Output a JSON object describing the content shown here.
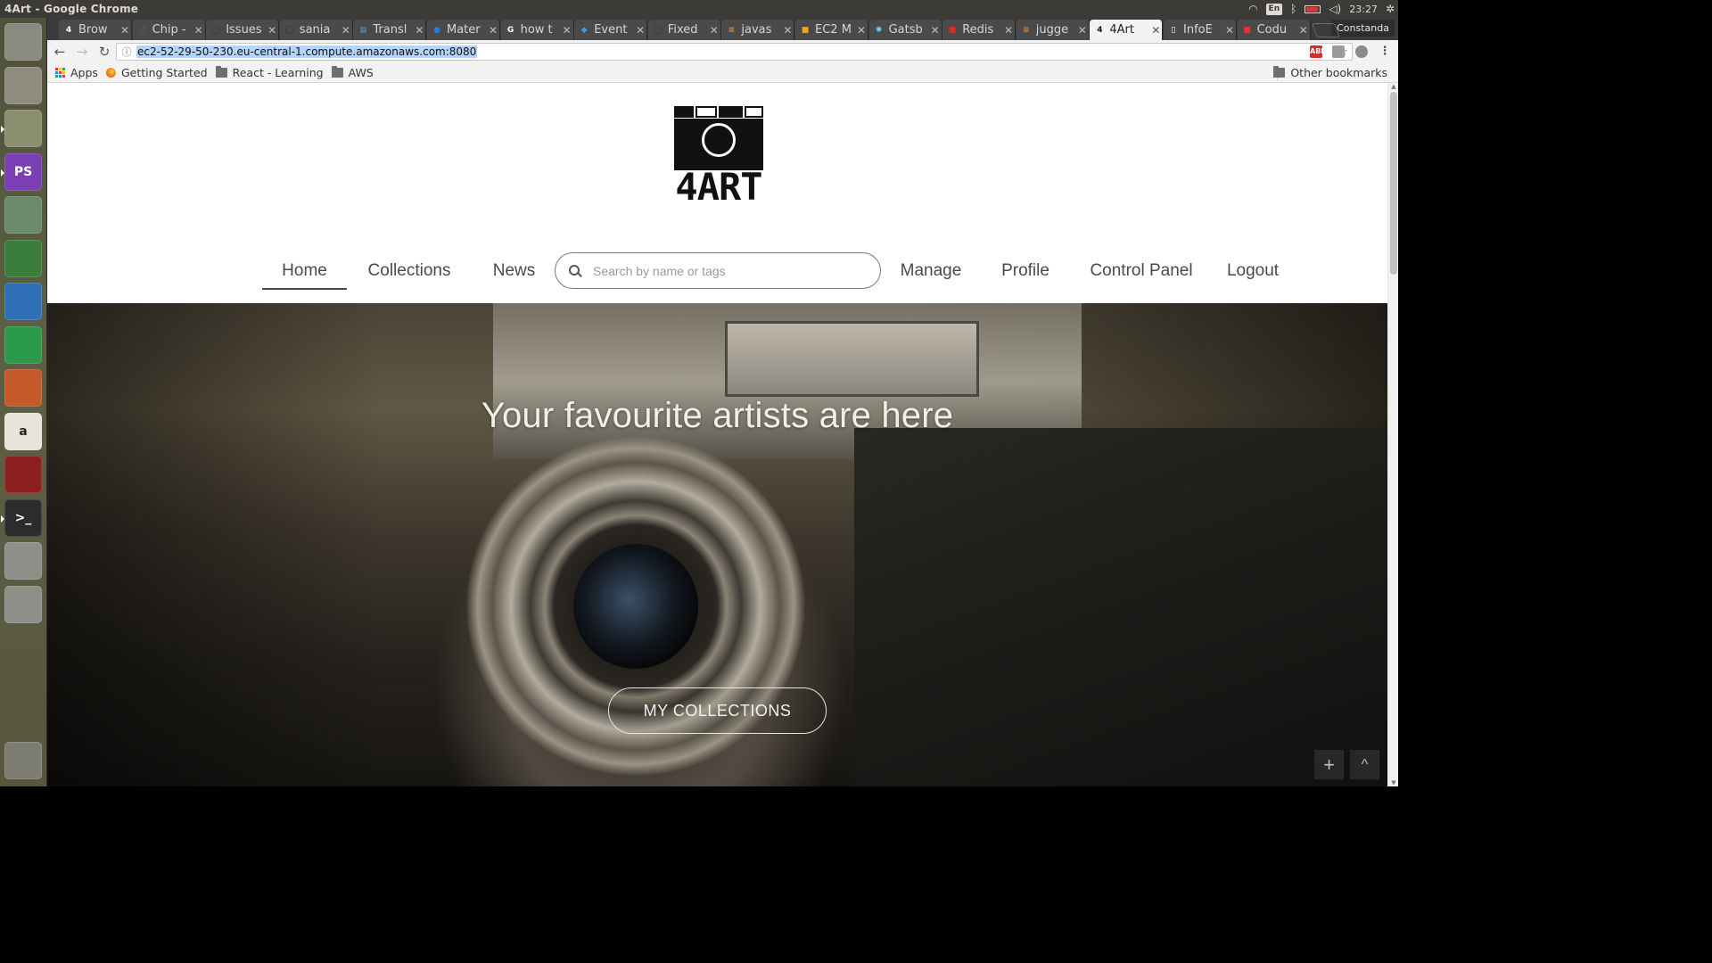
{
  "os": {
    "window_title": "4Art - Google Chrome",
    "clock": "23:27",
    "keyboard_layout": "En",
    "user": "Constanda"
  },
  "browser": {
    "tabs": [
      {
        "label": "Brow",
        "favicon": "4",
        "color": "#ffffff"
      },
      {
        "label": "Chip -",
        "favicon": "↺",
        "color": "#555555"
      },
      {
        "label": "Issues",
        "favicon": "◯",
        "color": "#333333"
      },
      {
        "label": "sania",
        "favicon": "◯",
        "color": "#333333"
      },
      {
        "label": "Transl",
        "favicon": "▦",
        "color": "#5b7fb5"
      },
      {
        "label": "Mater",
        "favicon": "●",
        "color": "#2a7bde"
      },
      {
        "label": "how t",
        "favicon": "G",
        "color": "#ffffff"
      },
      {
        "label": "Event",
        "favicon": "◆",
        "color": "#3aa0e8"
      },
      {
        "label": "Fixed",
        "favicon": "◯",
        "color": "#333333"
      },
      {
        "label": "javas",
        "favicon": "≡",
        "color": "#f48024"
      },
      {
        "label": "EC2 M",
        "favicon": "■",
        "color": "#f0a31e"
      },
      {
        "label": "Gatsb",
        "favicon": "✺",
        "color": "#61dafb"
      },
      {
        "label": "Redis",
        "favicon": "■",
        "color": "#d82c20"
      },
      {
        "label": "jugge",
        "favicon": "≡",
        "color": "#f48024"
      },
      {
        "label": "4Art",
        "favicon": "4",
        "color": "#111111",
        "active": true
      },
      {
        "label": "InfoE",
        "favicon": "▯",
        "color": "#ffffff"
      },
      {
        "label": "Codu",
        "favicon": "■",
        "color": "#e23636"
      }
    ],
    "url": "ec2-52-29-50-230.eu-central-1.compute.amazonaws.com:8080",
    "bookmarks": [
      {
        "label": "Apps",
        "icon": "apps-grid-icon"
      },
      {
        "label": "Getting Started",
        "icon": "firefox-icon"
      },
      {
        "label": "React - Learning",
        "icon": "folder-icon"
      },
      {
        "label": "AWS",
        "icon": "folder-icon"
      }
    ],
    "other_bookmarks": "Other bookmarks",
    "extensions": [
      "ABP"
    ]
  },
  "launcher": {
    "apps": [
      {
        "name": "ubuntu-dash-icon",
        "label": "",
        "color": "#8a8a80"
      },
      {
        "name": "files-icon",
        "label": "",
        "color": "#8f8b7e"
      },
      {
        "name": "chrome-icon",
        "label": "",
        "color": "#8b8f70"
      },
      {
        "name": "phpstorm-icon",
        "label": "PS",
        "color": "#7b3fb5"
      },
      {
        "name": "android-studio-icon",
        "label": "",
        "color": "#6a8a6a"
      },
      {
        "name": "mongodb-compass-icon",
        "label": "",
        "color": "#3b7d3b"
      },
      {
        "name": "libreoffice-writer-icon",
        "label": "",
        "color": "#2f6fb5"
      },
      {
        "name": "libreoffice-calc-icon",
        "label": "",
        "color": "#2c9a4b"
      },
      {
        "name": "libreoffice-impress-icon",
        "label": "",
        "color": "#c45a2a"
      },
      {
        "name": "amazon-icon",
        "label": "a",
        "color": "#e8e4dc"
      },
      {
        "name": "system-settings-icon",
        "label": "",
        "color": "#8d1f1f"
      },
      {
        "name": "terminal-icon",
        "label": ">_",
        "color": "#2c2c2c"
      },
      {
        "name": "drive-icon",
        "label": "",
        "color": "#8f8f8a"
      },
      {
        "name": "drive-2-icon",
        "label": "",
        "color": "#8f8f8a"
      },
      {
        "name": "trash-icon",
        "label": "",
        "color": "#7c7c72"
      }
    ]
  },
  "site": {
    "logo_text": "4ART",
    "nav": {
      "home": "Home",
      "collections": "Collections",
      "news": "News",
      "search_placeholder": "Search by name or tags",
      "manage": "Manage",
      "profile": "Profile",
      "control_panel": "Control Panel",
      "logout": "Logout"
    },
    "hero": {
      "title": "Your favourite artists are here",
      "button": "MY COLLECTIONS"
    },
    "floating": {
      "add": "+",
      "up": "^"
    }
  }
}
